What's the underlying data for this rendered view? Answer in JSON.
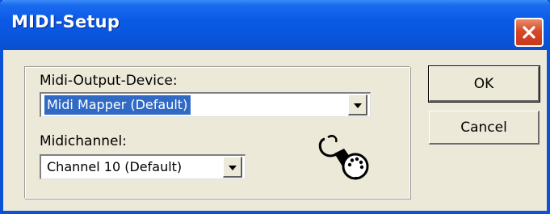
{
  "window": {
    "title": "MIDI-Setup",
    "titlebar_color": "#0a55dc",
    "close_button_color": "#d5492a",
    "close_icon": "close-icon"
  },
  "output_device": {
    "label": "Midi-Output-Device:",
    "selected_value": "Midi Mapper (Default)",
    "selection_highlight": "#316ac5",
    "dropdown_icon": "chevron-down-icon"
  },
  "channel": {
    "label": "Midichannel:",
    "selected_value": "Channel 10 (Default)",
    "dropdown_icon": "chevron-down-icon"
  },
  "buttons": {
    "ok": "OK",
    "cancel": "Cancel"
  },
  "decoration": {
    "icon": "midi-connector-icon"
  }
}
